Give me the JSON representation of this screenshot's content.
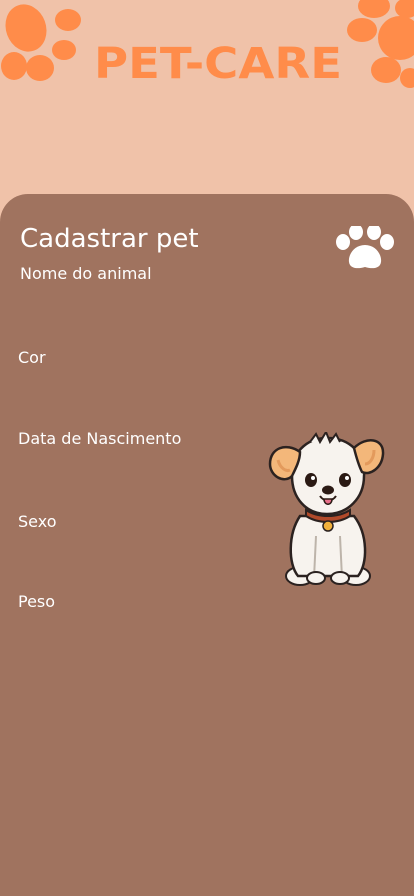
{
  "app": {
    "brand": "PET-CARE"
  },
  "form": {
    "title": "Cadastrar pet",
    "fields": [
      {
        "label": "Nome do animal"
      },
      {
        "label": "Cor"
      },
      {
        "label": "Data de Nascimento"
      },
      {
        "label": "Sexo"
      },
      {
        "label": "Peso"
      }
    ]
  },
  "colors": {
    "background": "#F0C2A9",
    "accent": "#FF8C4A",
    "card": "#A0735F",
    "text": "#FFFFFF"
  },
  "icons": {
    "header_left": "paw-icon",
    "header_right": "paw-icon",
    "card": "paw-icon",
    "illustration": "dog-illustration"
  }
}
